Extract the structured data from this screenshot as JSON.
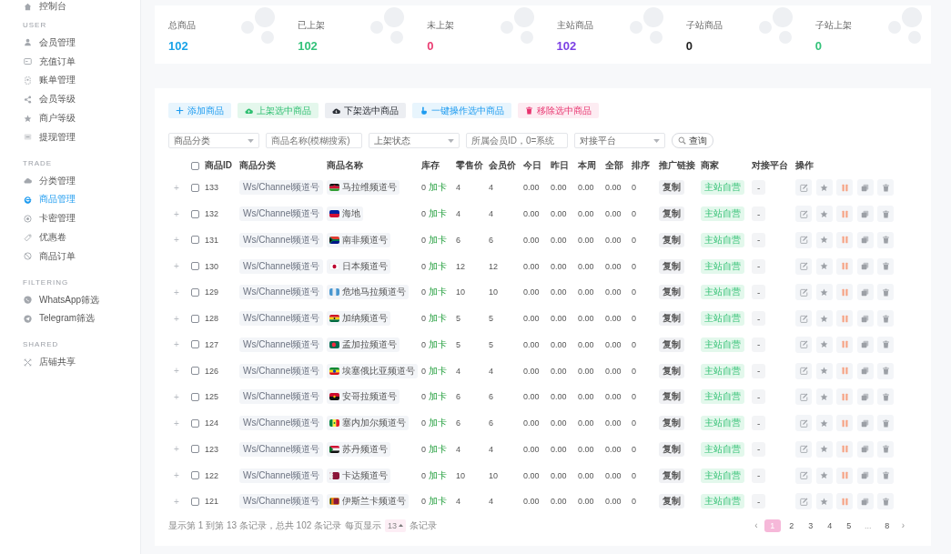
{
  "sidebar": {
    "top_item": {
      "label": "控制台",
      "selected": false
    },
    "sections": [
      {
        "title": "USER",
        "items": [
          {
            "label": "会员管理",
            "selected": false
          },
          {
            "label": "充值订单",
            "selected": false
          },
          {
            "label": "账单管理",
            "selected": false
          },
          {
            "label": "会员等级",
            "selected": false
          },
          {
            "label": "商户等级",
            "selected": false
          },
          {
            "label": "提现管理",
            "selected": false
          }
        ]
      },
      {
        "title": "TRADE",
        "items": [
          {
            "label": "分类管理",
            "selected": false
          },
          {
            "label": "商品管理",
            "selected": true
          },
          {
            "label": "卡密管理",
            "selected": false
          },
          {
            "label": "优惠卷",
            "selected": false
          },
          {
            "label": "商品订单",
            "selected": false
          }
        ]
      },
      {
        "title": "FILTERING",
        "items": [
          {
            "label": "WhatsApp筛选",
            "selected": false
          },
          {
            "label": "Telegram筛选",
            "selected": false
          }
        ]
      },
      {
        "title": "SHARED",
        "items": [
          {
            "label": "店铺共享",
            "selected": false
          }
        ]
      }
    ]
  },
  "stats": [
    {
      "label": "总商品",
      "value": "102",
      "color": "#1aa3e8"
    },
    {
      "label": "已上架",
      "value": "102",
      "color": "#34c27a"
    },
    {
      "label": "未上架",
      "value": "0",
      "color": "#ea3d72"
    },
    {
      "label": "主站商品",
      "value": "102",
      "color": "#7b3fe4"
    },
    {
      "label": "子站商品",
      "value": "0",
      "color": "#222222"
    },
    {
      "label": "子站上架",
      "value": "0",
      "color": "#34c27a"
    }
  ],
  "toolbar": {
    "buttons": [
      {
        "label": "添加商品",
        "kind": "info"
      },
      {
        "label": "上架选中商品",
        "kind": "success"
      },
      {
        "label": "下架选中商品",
        "kind": "dark"
      },
      {
        "label": "一键操作选中商品",
        "kind": "info"
      },
      {
        "label": "移除选中商品",
        "kind": "danger"
      }
    ]
  },
  "filters": {
    "fields": [
      {
        "kind": "select",
        "value": "商品分类"
      },
      {
        "kind": "input",
        "placeholder": "商品名称(模糊搜索)"
      },
      {
        "kind": "select",
        "value": "上架状态"
      },
      {
        "kind": "input",
        "placeholder": "所属会员ID，0=系统"
      },
      {
        "kind": "select",
        "value": "对接平台"
      }
    ],
    "search_button": {
      "label": "查询"
    }
  },
  "table": {
    "select_all": {
      "checked": false
    },
    "columns": [
      "商品ID",
      "商品分类",
      "商品名称",
      "库存",
      "零售价",
      "会员价",
      "今日",
      "昨日",
      "本周",
      "全部",
      "排序",
      "推广链接",
      "商家",
      "对接平台",
      "操作"
    ],
    "rows": [
      {
        "expand": "+",
        "checked": false,
        "id": "133",
        "category": "Ws/Channel频道号",
        "name": "马拉维频道号",
        "stock": "0",
        "stock_action": "加卡",
        "retail_price": "4",
        "member_price": "4",
        "today": "0.00",
        "yesterday": "0.00",
        "week": "0.00",
        "total": "0.00",
        "sort": "0",
        "promo_link": "复制",
        "merchant": "主站自营",
        "platform": "-"
      },
      {
        "expand": "+",
        "checked": false,
        "id": "132",
        "category": "Ws/Channel频道号",
        "name": "海地",
        "stock": "0",
        "stock_action": "加卡",
        "retail_price": "4",
        "member_price": "4",
        "today": "0.00",
        "yesterday": "0.00",
        "week": "0.00",
        "total": "0.00",
        "sort": "0",
        "promo_link": "复制",
        "merchant": "主站自营",
        "platform": "-"
      },
      {
        "expand": "+",
        "checked": false,
        "id": "131",
        "category": "Ws/Channel频道号",
        "name": "南非频道号",
        "stock": "0",
        "stock_action": "加卡",
        "retail_price": "6",
        "member_price": "6",
        "today": "0.00",
        "yesterday": "0.00",
        "week": "0.00",
        "total": "0.00",
        "sort": "0",
        "promo_link": "复制",
        "merchant": "主站自营",
        "platform": "-"
      },
      {
        "expand": "+",
        "checked": false,
        "id": "130",
        "category": "Ws/Channel频道号",
        "name": "日本频道号",
        "stock": "0",
        "stock_action": "加卡",
        "retail_price": "12",
        "member_price": "12",
        "today": "0.00",
        "yesterday": "0.00",
        "week": "0.00",
        "total": "0.00",
        "sort": "0",
        "promo_link": "复制",
        "merchant": "主站自营",
        "platform": "-"
      },
      {
        "expand": "+",
        "checked": false,
        "id": "129",
        "category": "Ws/Channel频道号",
        "name": "危地马拉频道号",
        "stock": "0",
        "stock_action": "加卡",
        "retail_price": "10",
        "member_price": "10",
        "today": "0.00",
        "yesterday": "0.00",
        "week": "0.00",
        "total": "0.00",
        "sort": "0",
        "promo_link": "复制",
        "merchant": "主站自营",
        "platform": "-"
      },
      {
        "expand": "+",
        "checked": false,
        "id": "128",
        "category": "Ws/Channel频道号",
        "name": "加纳频道号",
        "stock": "0",
        "stock_action": "加卡",
        "retail_price": "5",
        "member_price": "5",
        "today": "0.00",
        "yesterday": "0.00",
        "week": "0.00",
        "total": "0.00",
        "sort": "0",
        "promo_link": "复制",
        "merchant": "主站自营",
        "platform": "-"
      },
      {
        "expand": "+",
        "checked": false,
        "id": "127",
        "category": "Ws/Channel频道号",
        "name": "孟加拉频道号",
        "stock": "0",
        "stock_action": "加卡",
        "retail_price": "5",
        "member_price": "5",
        "today": "0.00",
        "yesterday": "0.00",
        "week": "0.00",
        "total": "0.00",
        "sort": "0",
        "promo_link": "复制",
        "merchant": "主站自营",
        "platform": "-"
      },
      {
        "expand": "+",
        "checked": false,
        "id": "126",
        "category": "Ws/Channel频道号",
        "name": "埃塞俄比亚频道号",
        "stock": "0",
        "stock_action": "加卡",
        "retail_price": "4",
        "member_price": "4",
        "today": "0.00",
        "yesterday": "0.00",
        "week": "0.00",
        "total": "0.00",
        "sort": "0",
        "promo_link": "复制",
        "merchant": "主站自营",
        "platform": "-"
      },
      {
        "expand": "+",
        "checked": false,
        "id": "125",
        "category": "Ws/Channel频道号",
        "name": "安哥拉频道号",
        "stock": "0",
        "stock_action": "加卡",
        "retail_price": "6",
        "member_price": "6",
        "today": "0.00",
        "yesterday": "0.00",
        "week": "0.00",
        "total": "0.00",
        "sort": "0",
        "promo_link": "复制",
        "merchant": "主站自营",
        "platform": "-"
      },
      {
        "expand": "+",
        "checked": false,
        "id": "124",
        "category": "Ws/Channel频道号",
        "name": "塞内加尔频道号",
        "stock": "0",
        "stock_action": "加卡",
        "retail_price": "6",
        "member_price": "6",
        "today": "0.00",
        "yesterday": "0.00",
        "week": "0.00",
        "total": "0.00",
        "sort": "0",
        "promo_link": "复制",
        "merchant": "主站自营",
        "platform": "-"
      },
      {
        "expand": "+",
        "checked": false,
        "id": "123",
        "category": "Ws/Channel频道号",
        "name": "苏丹频道号",
        "stock": "0",
        "stock_action": "加卡",
        "retail_price": "4",
        "member_price": "4",
        "today": "0.00",
        "yesterday": "0.00",
        "week": "0.00",
        "total": "0.00",
        "sort": "0",
        "promo_link": "复制",
        "merchant": "主站自营",
        "platform": "-"
      },
      {
        "expand": "+",
        "checked": false,
        "id": "122",
        "category": "Ws/Channel频道号",
        "name": "卡达频道号",
        "stock": "0",
        "stock_action": "加卡",
        "retail_price": "10",
        "member_price": "10",
        "today": "0.00",
        "yesterday": "0.00",
        "week": "0.00",
        "total": "0.00",
        "sort": "0",
        "promo_link": "复制",
        "merchant": "主站自营",
        "platform": "-"
      },
      {
        "expand": "+",
        "checked": false,
        "id": "121",
        "category": "Ws/Channel频道号",
        "name": "伊斯兰卡频道号",
        "stock": "0",
        "stock_action": "加卡",
        "retail_price": "4",
        "member_price": "4",
        "today": "0.00",
        "yesterday": "0.00",
        "week": "0.00",
        "total": "0.00",
        "sort": "0",
        "promo_link": "复制",
        "merchant": "主站自营",
        "platform": "-"
      }
    ]
  },
  "table_footer": {
    "summary": "显示第 1 到第 13 条记录，总共 102 条记录",
    "page_size_label": "每页显示",
    "page_size": "13",
    "page_size_suffix": "条记录"
  },
  "pagination": {
    "prev": "‹",
    "pages": [
      {
        "label": "1",
        "kind": "page",
        "selected": true
      },
      {
        "label": "2",
        "kind": "page",
        "selected": false
      },
      {
        "label": "3",
        "kind": "page",
        "selected": false
      },
      {
        "label": "4",
        "kind": "page",
        "selected": false
      },
      {
        "label": "5",
        "kind": "page",
        "selected": false
      },
      {
        "label": "...",
        "kind": "gap",
        "selected": false
      },
      {
        "label": "8",
        "kind": "page",
        "selected": false
      }
    ],
    "next": "›"
  }
}
